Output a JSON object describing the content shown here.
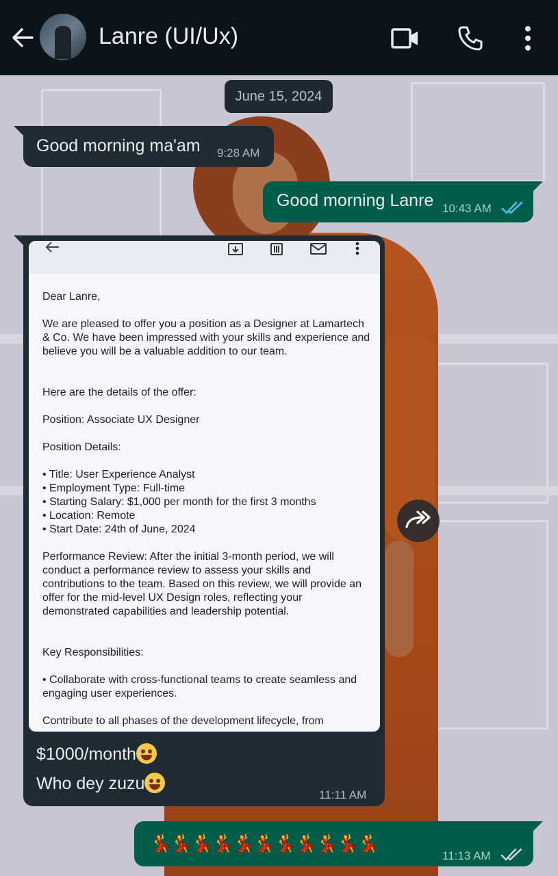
{
  "header": {
    "contact_name": "Lanre (UI/Ux)",
    "icons": [
      "arrow-left-icon",
      "video-call-icon",
      "phone-icon",
      "more-vert-icon"
    ]
  },
  "date_separator": "June 15, 2024",
  "messages": [
    {
      "direction": "incoming",
      "text": "Good morning ma'am",
      "time": "9:28 AM"
    },
    {
      "direction": "outgoing",
      "text": "Good morning Lanre",
      "time": "10:43 AM",
      "status": "read"
    },
    {
      "direction": "incoming",
      "type": "image-with-caption",
      "caption_line1": "$1000/month",
      "caption_line2": "Who dey zuzu",
      "time": "11:11 AM",
      "email": {
        "greeting": "Dear Lanre,",
        "intro": "We are pleased to offer you a position as a Designer at Lamartech & Co. We have been impressed with your skills and experience and believe you will be a valuable addition to our team.",
        "details_heading": "Here are the details of the offer:",
        "position": "Position: Associate UX Designer",
        "position_details_heading": "Position Details:",
        "bullets": [
          "• Title: User Experience Analyst",
          "• Employment Type: Full-time",
          "• Starting Salary: $1,000 per month for the first 3 months",
          "• Location: Remote",
          "• Start Date: 24th of June, 2024"
        ],
        "performance_review": "Performance Review: After the initial 3-month period, we will conduct a performance review to assess your skills and contributions to the team. Based on this review, we will provide an offer for the mid-level UX Design roles, reflecting your demonstrated capabilities and leadership potential.",
        "responsibilities_heading": "Key Responsibilities:",
        "responsibility_1": "• Collaborate with cross-functional teams to create seamless and engaging user experiences.",
        "cut_off_line": "Contribute to all phases of the development lifecycle, from"
      }
    },
    {
      "direction": "outgoing",
      "text": "💃💃💃💃💃💃💃💃💃💃💃",
      "time": "11:13 AM",
      "status": "delivered"
    }
  ],
  "colors": {
    "header_bg": "#0b141a",
    "incoming_bubble": "#1f2c34",
    "outgoing_bubble": "#005c4b",
    "read_tick": "#53bdeb"
  }
}
